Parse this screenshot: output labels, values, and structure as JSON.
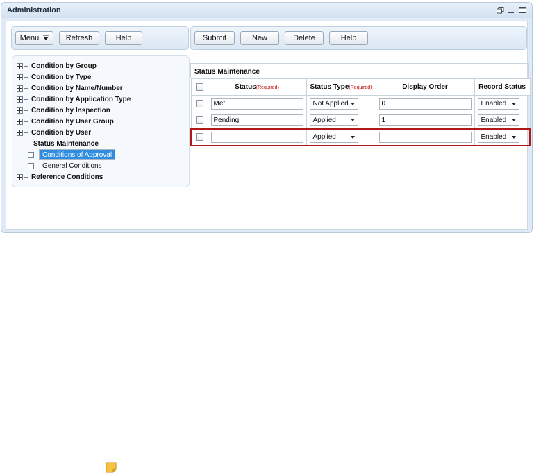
{
  "window": {
    "title": "Administration"
  },
  "toolbar_left": {
    "menu": "Menu",
    "refresh": "Refresh",
    "help": "Help"
  },
  "toolbar_right": {
    "submit": "Submit",
    "new": "New",
    "delete": "Delete",
    "help": "Help"
  },
  "tree": {
    "items": [
      {
        "label": "Condition by Group"
      },
      {
        "label": "Condition by Type"
      },
      {
        "label": "Condition by Name/Number"
      },
      {
        "label": "Condition by Application Type"
      },
      {
        "label": "Condition by Inspection"
      },
      {
        "label": "Condition by User Group"
      },
      {
        "label": "Condition by User"
      },
      {
        "label": "Status Maintenance"
      },
      {
        "label": "Conditions of Approval"
      },
      {
        "label": "General Conditions"
      },
      {
        "label": "Reference Conditions"
      }
    ]
  },
  "grid": {
    "title": "Status Maintenance",
    "columns": {
      "status": "Status",
      "status_required": "(Required)",
      "status_type": "Status Type",
      "status_type_required": "(Required)",
      "display_order": "Display Order",
      "record_status": "Record Status"
    },
    "rows": [
      {
        "status": "Met",
        "status_type": "Not Applied",
        "display_order": "0",
        "record_status": "Enabled"
      },
      {
        "status": "Pending",
        "status_type": "Applied",
        "display_order": "1",
        "record_status": "Enabled"
      },
      {
        "status": "",
        "status_type": "Applied",
        "display_order": "",
        "record_status": "Enabled"
      }
    ]
  },
  "icons": {
    "window_controls": [
      "restore-icon",
      "minimize-icon",
      "maximize-icon"
    ],
    "footer": "note-icon"
  },
  "colors": {
    "required": "#c00000",
    "selected": "#2e8de0",
    "new_row_border": "#b01818"
  }
}
